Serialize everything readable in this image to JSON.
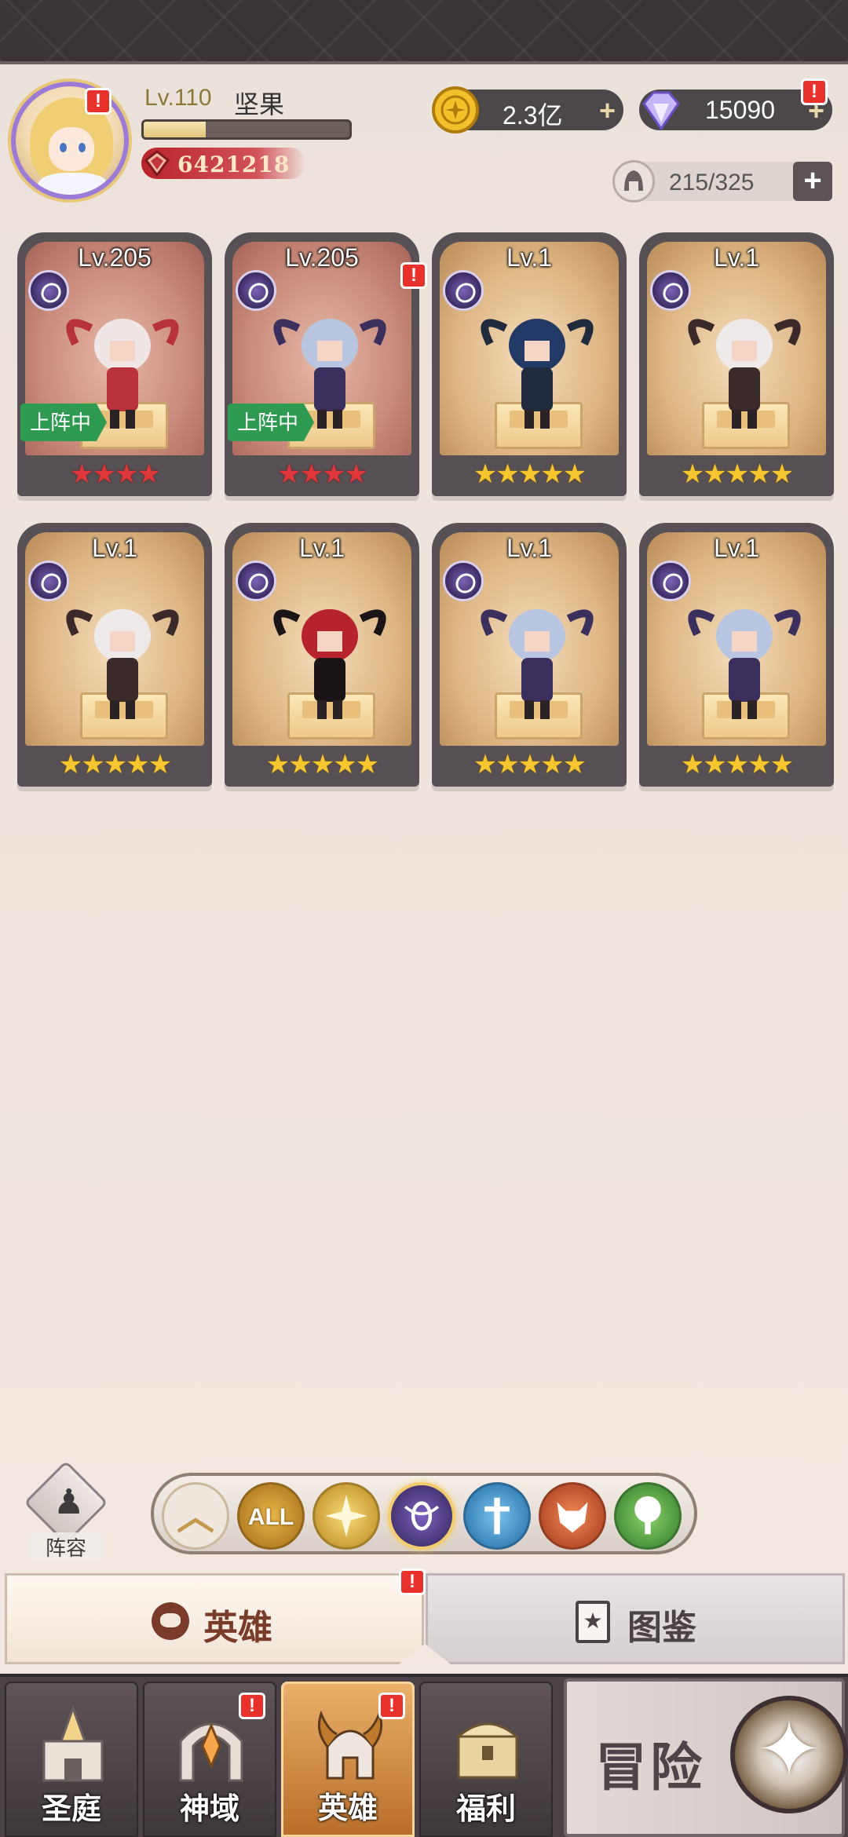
{
  "player": {
    "level_label": "Lv.110",
    "name": "坚果",
    "power": "6421218",
    "exp_fraction": 0.3
  },
  "currencies": {
    "gold": "2.3亿",
    "gems": "15090",
    "plus_symbol": "+",
    "hero_capacity": "215/325"
  },
  "heroes": [
    {
      "level": "Lv.205",
      "stars": "★★★★",
      "star_color": "red",
      "deployed_label": "上阵中",
      "alert": false
    },
    {
      "level": "Lv.205",
      "stars": "★★★★",
      "star_color": "red",
      "deployed_label": "上阵中",
      "alert": true
    },
    {
      "level": "Lv.1",
      "stars": "★★★★★",
      "star_color": "gold",
      "deployed_label": "",
      "alert": false
    },
    {
      "level": "Lv.1",
      "stars": "★★★★★",
      "star_color": "gold",
      "deployed_label": "",
      "alert": false
    },
    {
      "level": "Lv.1",
      "stars": "★★★★★",
      "star_color": "gold",
      "deployed_label": "",
      "alert": false
    },
    {
      "level": "Lv.1",
      "stars": "★★★★★",
      "star_color": "gold",
      "deployed_label": "",
      "alert": false
    },
    {
      "level": "Lv.1",
      "stars": "★★★★★",
      "star_color": "gold",
      "deployed_label": "",
      "alert": false
    },
    {
      "level": "Lv.1",
      "stars": "★★★★★",
      "star_color": "gold",
      "deployed_label": "",
      "alert": false
    }
  ],
  "alert_mark": "!",
  "lineup": {
    "label": "阵容",
    "icon": "♟"
  },
  "filters": {
    "collapse_icon": "︿",
    "all_label": "ALL",
    "factions": [
      "light",
      "dark",
      "water",
      "fire",
      "wood"
    ],
    "selected": "dark"
  },
  "tabs": {
    "heroes": "英雄",
    "codex": "图鉴",
    "codex_icon": "★"
  },
  "nav": {
    "items": [
      "圣庭",
      "神域",
      "英雄",
      "福利"
    ],
    "active": "英雄",
    "adventure": "冒险"
  }
}
